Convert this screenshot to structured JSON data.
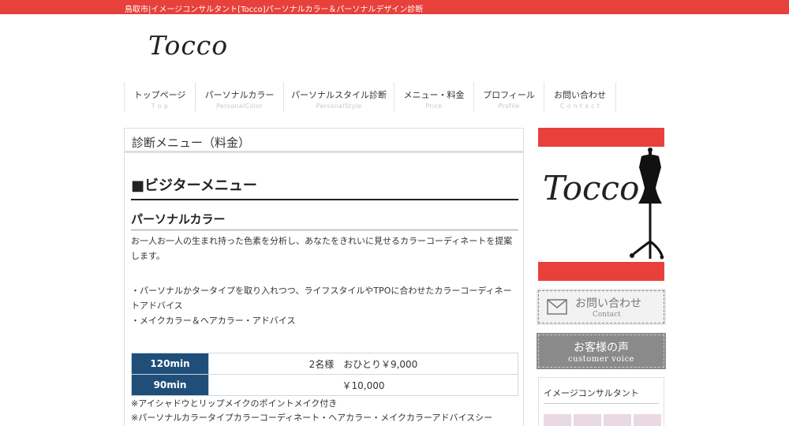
{
  "header": {
    "tagline": "鳥取市|イメージコンサルタント[Tocco]パーソナルカラー＆パーソナルデザイン診断",
    "logo": "Tocco"
  },
  "nav": [
    {
      "jp": "トップページ",
      "en": "T o p"
    },
    {
      "jp": "パーソナルカラー",
      "en": "PersonalColor"
    },
    {
      "jp": "パーソナルスタイル診断",
      "en": "PersonalStyle"
    },
    {
      "jp": "メニュー・料金",
      "en": "Price"
    },
    {
      "jp": "プロフィール",
      "en": "Profile"
    },
    {
      "jp": "お問い合わせ",
      "en": "C o n t a c t"
    }
  ],
  "main": {
    "page_title": "診断メニュー（料金）",
    "section_title": "■ビジターメニュー",
    "subsection_title": "パーソナルカラー",
    "intro": "お一人お一人の生まれ持った色素を分析し、あなたをきれいに見せるカラーコーディネートを提案します。",
    "bullets": [
      "・パーソナルかタータイプを取り入れつつ、ライフスタイルやTPOに合わせたカラーコーディネートアドバイス",
      "・メイクカラー＆ヘアカラー・アドバイス"
    ],
    "prices": [
      {
        "duration": "120min",
        "price": "2名様　おひとり￥9,000"
      },
      {
        "duration": "90min",
        "price": "￥10,000"
      }
    ],
    "notes": [
      "※アイシャドウとリップメイクのポイントメイク付き",
      "※パーソナルカラータイプカラーコーディネート・ヘアカラー・メイクカラーアドバイスシー"
    ]
  },
  "sidebar": {
    "banner_logo": "Tocco",
    "contact_jp": "お問い合わせ",
    "contact_en": "Contact",
    "voice_jp": "お客様の声",
    "voice_en": "customer voice",
    "widget_title": "イメージコンサルタント"
  },
  "colors": {
    "accent_red": "#e8403a",
    "table_navy": "#1f4e79",
    "button_gray": "#8a8a8a"
  }
}
